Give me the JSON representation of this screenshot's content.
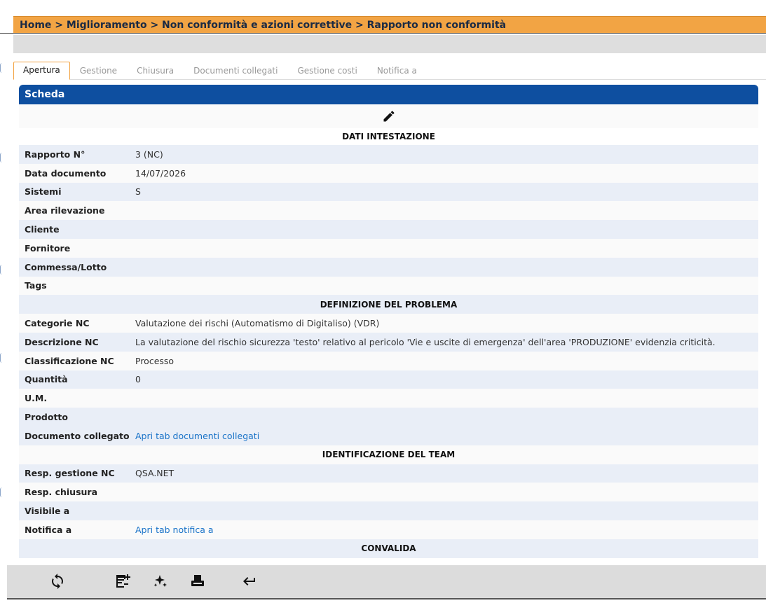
{
  "breadcrumb": {
    "text": "Home > Miglioramento > Non conformità e azioni correttive > Rapporto non conformità"
  },
  "tabs": [
    {
      "label": "Apertura",
      "active": true
    },
    {
      "label": "Gestione"
    },
    {
      "label": "Chiusura"
    },
    {
      "label": "Documenti collegati"
    },
    {
      "label": "Gestione costi"
    },
    {
      "label": "Notifica a"
    }
  ],
  "panel": {
    "title": "Scheda",
    "edit_icon": "pencil-icon",
    "sections": {
      "header": "DATI INTESTAZIONE",
      "problem": "DEFINIZIONE DEL PROBLEMA",
      "team": "IDENTIFICAZIONE DEL TEAM",
      "validation": "CONVALIDA"
    },
    "fields": {
      "rapporto": {
        "label": "Rapporto N°",
        "value": "3 (NC)"
      },
      "data_doc": {
        "label": "Data documento",
        "value": "14/07/2026"
      },
      "sistemi": {
        "label": "Sistemi",
        "value": "S"
      },
      "area": {
        "label": "Area rilevazione",
        "value": ""
      },
      "cliente": {
        "label": "Cliente",
        "value": ""
      },
      "fornitore": {
        "label": "Fornitore",
        "value": ""
      },
      "commessa": {
        "label": "Commessa/Lotto",
        "value": ""
      },
      "tags": {
        "label": "Tags",
        "value": ""
      },
      "categorie": {
        "label": "Categorie NC",
        "value": "Valutazione dei rischi (Automatismo di Digitaliso) (VDR)"
      },
      "descrizione": {
        "label": "Descrizione NC",
        "value": "La valutazione del rischio sicurezza 'testo' relativo al pericolo 'Vie e uscite di emergenza' dell'area 'PRODUZIONE' evidenzia criticità."
      },
      "classificazione": {
        "label": "Classificazione NC",
        "value": "Processo"
      },
      "quantita": {
        "label": "Quantità",
        "value": "0"
      },
      "um": {
        "label": "U.M.",
        "value": ""
      },
      "prodotto": {
        "label": "Prodotto",
        "value": ""
      },
      "documento": {
        "label": "Documento collegato",
        "value": "Apri tab documenti collegati"
      },
      "resp_gestione": {
        "label": "Resp. gestione NC",
        "value": "QSA.NET"
      },
      "resp_chiusura": {
        "label": "Resp. chiusura",
        "value": ""
      },
      "visibile": {
        "label": "Visibile a",
        "value": ""
      },
      "notifica": {
        "label": "Notifica a",
        "value": "Apri tab notifica a"
      }
    }
  },
  "footer": {
    "icons": [
      "refresh-icon",
      "add-note-icon",
      "sparkle-icon",
      "print-icon",
      "return-icon"
    ]
  },
  "colors": {
    "breadcrumb_bg": "#f2a444",
    "panel_header": "#0e4fa0",
    "row_shade": "#e9eef7",
    "link": "#1a73c8"
  }
}
